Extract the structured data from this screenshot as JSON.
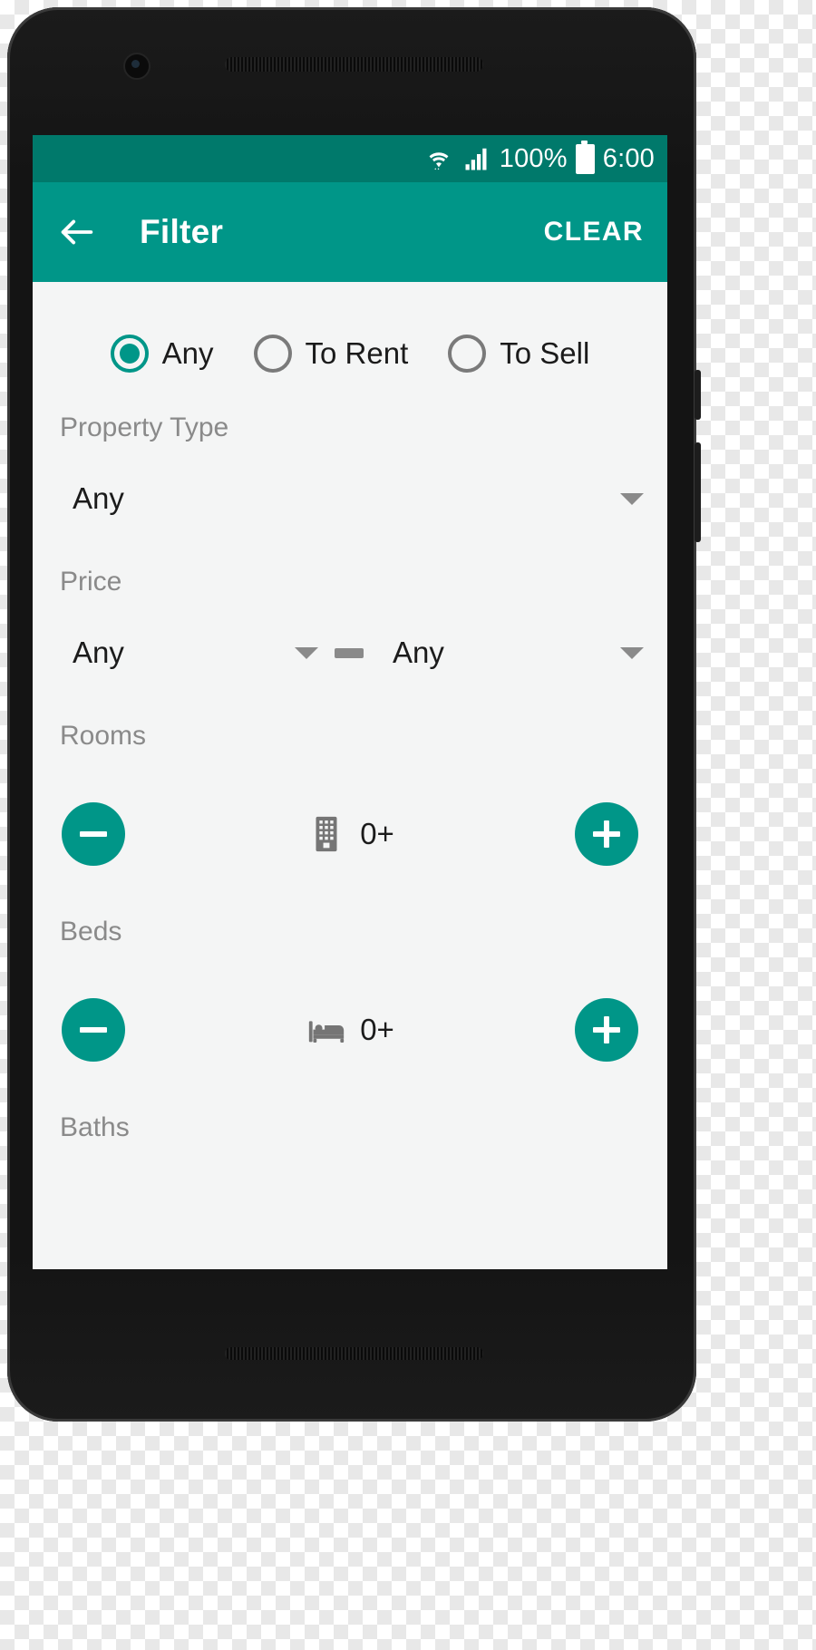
{
  "status_bar": {
    "wifi_icon": "wifi-icon",
    "signal_icon": "cellular-signal-icon",
    "battery_text": "100%",
    "battery_icon": "battery-full-icon",
    "time": "6:00"
  },
  "app_bar": {
    "back_icon": "back-arrow-icon",
    "title": "Filter",
    "clear_label": "CLEAR"
  },
  "listing_type": {
    "options": [
      {
        "label": "Any",
        "selected": true
      },
      {
        "label": "To Rent",
        "selected": false
      },
      {
        "label": "To Sell",
        "selected": false
      }
    ]
  },
  "property_type": {
    "label": "Property Type",
    "value": "Any",
    "caret_icon": "chevron-down-icon"
  },
  "price": {
    "label": "Price",
    "min_value": "Any",
    "max_value": "Any",
    "separator": "dash-icon",
    "caret_icon": "chevron-down-icon"
  },
  "rooms": {
    "label": "Rooms",
    "value": "0+",
    "icon": "apartment-building-icon",
    "decrement_icon": "minus-icon",
    "increment_icon": "plus-icon"
  },
  "beds": {
    "label": "Beds",
    "value": "0+",
    "icon": "bed-icon",
    "decrement_icon": "minus-icon",
    "increment_icon": "plus-icon"
  },
  "baths": {
    "label": "Baths"
  },
  "colors": {
    "primary": "#009688",
    "primary_dark": "#00796b",
    "screen_background": "#f4f5f5",
    "label_gray": "#8a8a8a",
    "text_dark": "#1b1b1b"
  }
}
